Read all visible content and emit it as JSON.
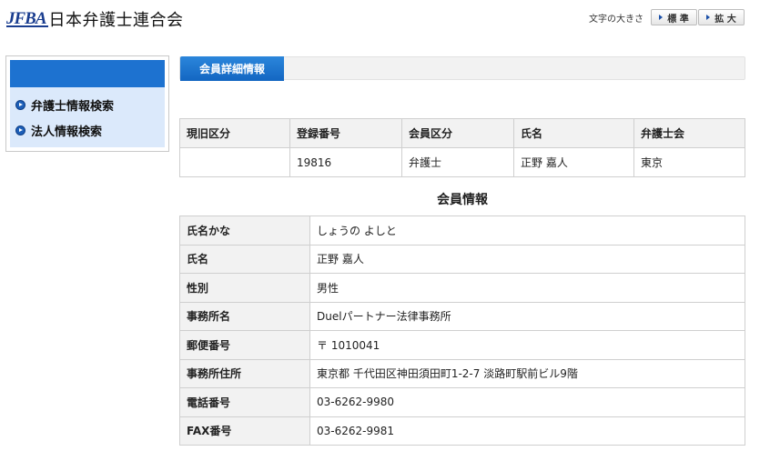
{
  "header": {
    "logo_mark": "JFBA",
    "logo_text": "日本弁護士連合会",
    "font_size_label": "文字の大きさ",
    "font_standard": "標 準",
    "font_large": "拡 大"
  },
  "sidebar": {
    "items": [
      {
        "label": "弁護士情報検索"
      },
      {
        "label": "法人情報検索"
      }
    ]
  },
  "main": {
    "title": "会員詳細情報",
    "summary": {
      "headers": [
        "現旧区分",
        "登録番号",
        "会員区分",
        "氏名",
        "弁護士会"
      ],
      "values": [
        "",
        "19816",
        "弁護士",
        "正野 嘉人",
        "東京"
      ]
    },
    "section_title": "会員情報",
    "details": [
      {
        "label": "氏名かな",
        "value": "しょうの よしと"
      },
      {
        "label": "氏名",
        "value": "正野 嘉人"
      },
      {
        "label": "性別",
        "value": "男性"
      },
      {
        "label": "事務所名",
        "value": "Duelパートナー法律事務所"
      },
      {
        "label": "郵便番号",
        "value": "〒 1010041"
      },
      {
        "label": "事務所住所",
        "value": "東京都 千代田区神田須田町1-2-7 淡路町駅前ビル9階"
      },
      {
        "label": "電話番号",
        "value": "03-6262-9980"
      },
      {
        "label": "FAX番号",
        "value": "03-6262-9981"
      }
    ]
  },
  "colors": {
    "accent": "#1d72d0",
    "sidebar_bg": "#dbe9fb",
    "header_cell_bg": "#f2f2f2"
  }
}
